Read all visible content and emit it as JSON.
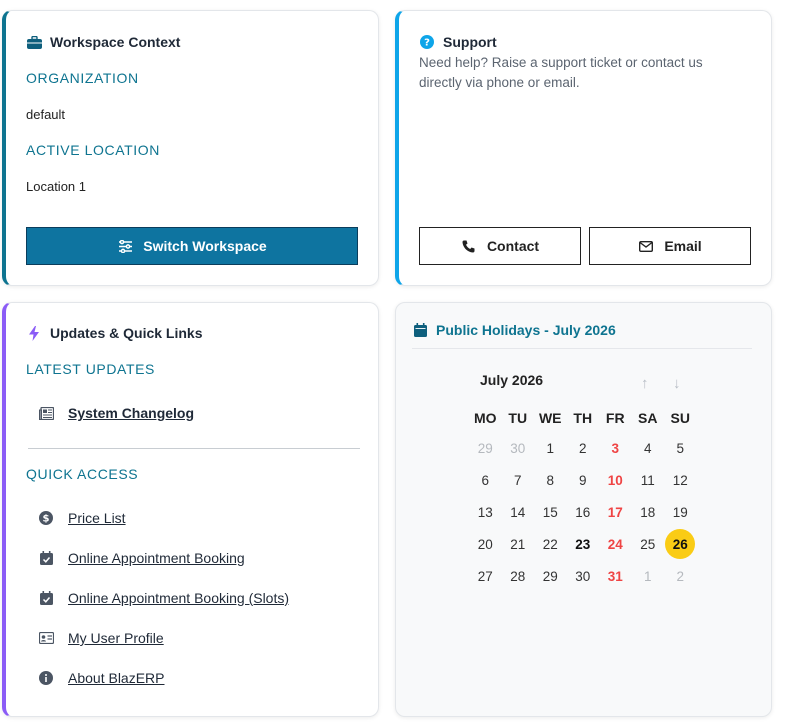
{
  "workspace": {
    "title": "Workspace Context",
    "org_label": "ORGANIZATION",
    "org_value": "default",
    "location_label": "ACTIVE LOCATION",
    "location_value": "Location 1",
    "switch_label": "Switch Workspace"
  },
  "support": {
    "title": "Support",
    "text": "Need help? Raise a support ticket or contact us directly via phone or email.",
    "contact_label": "Contact",
    "email_label": "Email"
  },
  "updates": {
    "title": "Updates & Quick Links",
    "latest_label": "LATEST UPDATES",
    "changelog": "System Changelog",
    "quick_label": "QUICK ACCESS",
    "links": [
      "Price List",
      "Online Appointment Booking",
      "Online Appointment Booking (Slots)",
      "My User Profile",
      "About BlazERP"
    ]
  },
  "holidays": {
    "title": "Public Holidays - July 2026",
    "month_label": "July 2026",
    "weekdays": [
      "MO",
      "TU",
      "WE",
      "TH",
      "FR",
      "SA",
      "SU"
    ],
    "weeks": [
      [
        {
          "d": "29",
          "t": "muted"
        },
        {
          "d": "30",
          "t": "muted"
        },
        {
          "d": "1",
          "t": ""
        },
        {
          "d": "2",
          "t": ""
        },
        {
          "d": "3",
          "t": "holiday"
        },
        {
          "d": "4",
          "t": ""
        },
        {
          "d": "5",
          "t": ""
        }
      ],
      [
        {
          "d": "6",
          "t": ""
        },
        {
          "d": "7",
          "t": ""
        },
        {
          "d": "8",
          "t": ""
        },
        {
          "d": "9",
          "t": ""
        },
        {
          "d": "10",
          "t": "holiday"
        },
        {
          "d": "11",
          "t": ""
        },
        {
          "d": "12",
          "t": ""
        }
      ],
      [
        {
          "d": "13",
          "t": ""
        },
        {
          "d": "14",
          "t": ""
        },
        {
          "d": "15",
          "t": ""
        },
        {
          "d": "16",
          "t": ""
        },
        {
          "d": "17",
          "t": "holiday"
        },
        {
          "d": "18",
          "t": ""
        },
        {
          "d": "19",
          "t": ""
        }
      ],
      [
        {
          "d": "20",
          "t": ""
        },
        {
          "d": "21",
          "t": ""
        },
        {
          "d": "22",
          "t": ""
        },
        {
          "d": "23",
          "t": "today"
        },
        {
          "d": "24",
          "t": "holiday"
        },
        {
          "d": "25",
          "t": ""
        },
        {
          "d": "26",
          "t": "selected"
        }
      ],
      [
        {
          "d": "27",
          "t": ""
        },
        {
          "d": "28",
          "t": ""
        },
        {
          "d": "29",
          "t": ""
        },
        {
          "d": "30",
          "t": ""
        },
        {
          "d": "31",
          "t": "holiday"
        },
        {
          "d": "1",
          "t": "muted"
        },
        {
          "d": "2",
          "t": "muted"
        }
      ]
    ]
  },
  "colors": {
    "accent": "#0e7490",
    "support_accent": "#0ea5e9",
    "updates_accent": "#8b5cf6",
    "holiday": "#ef4444",
    "selected": "#facc15"
  }
}
